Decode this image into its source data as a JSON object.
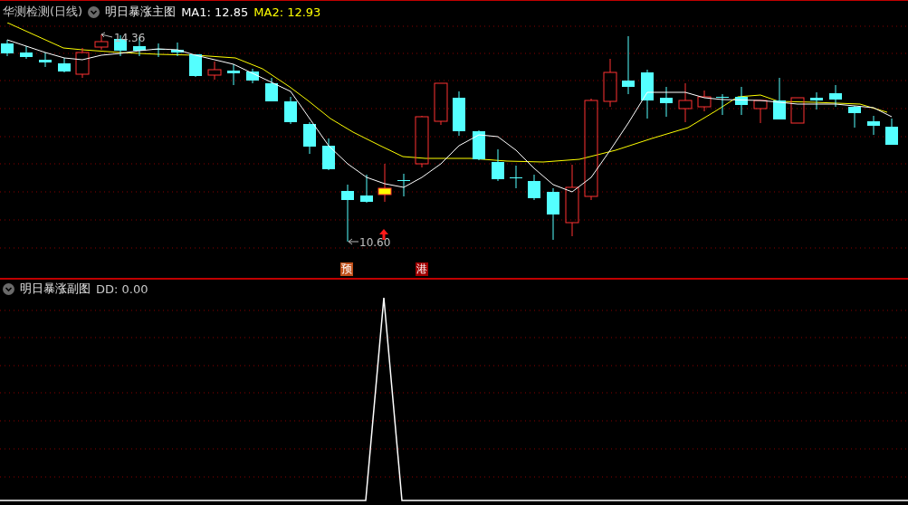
{
  "main_panel": {
    "stock_title": "华测检测(日线)",
    "indicator": "明日暴涨主图",
    "ma_readings": [
      {
        "text": "MA1: 12.85",
        "color": "#ffffff"
      },
      {
        "text": "MA2: 12.93",
        "color": "#ffff00"
      }
    ],
    "high_label": "14.36",
    "low_label": "10.60",
    "signals": [
      {
        "text": "预",
        "color": "#c0501a"
      },
      {
        "text": "港",
        "color": "#a00000"
      }
    ]
  },
  "sub_panel": {
    "indicator": "明日暴涨副图",
    "reading": "DD: 0.00"
  }
}
